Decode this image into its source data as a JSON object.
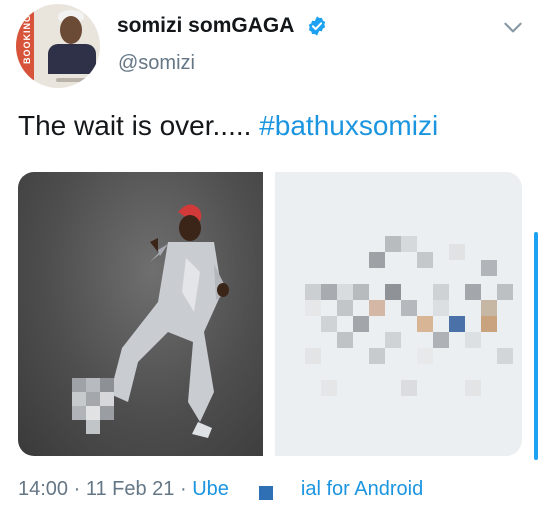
{
  "user": {
    "display_name": "somizi somGAGA",
    "handle": "@somizi",
    "avatar_band_text": "BOOKING",
    "verified": true,
    "verified_icon": "verified-badge-icon",
    "menu_icon": "chevron-down-icon"
  },
  "tweet": {
    "text": "The wait is over..... ",
    "hashtag": "#bathuxsomizi"
  },
  "footer": {
    "time": "14:00",
    "sep1": " · ",
    "date": "11 Feb 21",
    "sep2": " · ",
    "source_start": "Ube",
    "source_end": "ial for Android"
  },
  "colors": {
    "link": "#1b95e0",
    "muted": "#657786",
    "text": "#14171a"
  }
}
